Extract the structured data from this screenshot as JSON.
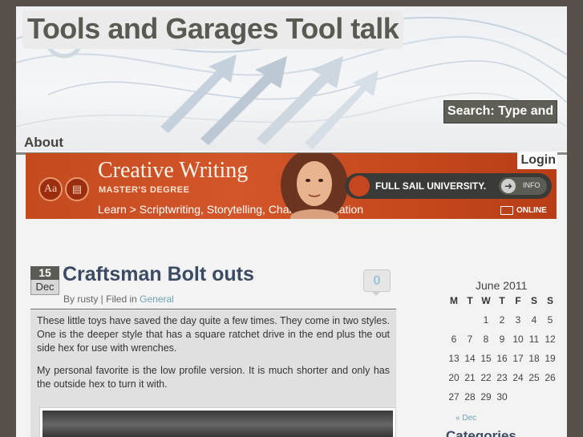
{
  "header": {
    "site_title": "Tools and Garages Tool talk",
    "search_placeholder": "Search: Type and"
  },
  "nav": {
    "items": [
      {
        "label": "About"
      }
    ]
  },
  "login_label": "Login",
  "banner": {
    "aa_label": "Aa",
    "title": "Creative Writing",
    "subtitle": "MASTER'S DEGREE",
    "tagline": "Learn > Scriptwriting, Storytelling, Character Creation",
    "school": "FULL SAIL UNIVERSITY.",
    "info_label": "INFO",
    "online_label": "ONLINE"
  },
  "post": {
    "date_day": "15",
    "date_month": "Dec",
    "title": "Craftsman Bolt outs",
    "comment_count": "0",
    "meta_author": "By rusty | Filed in",
    "meta_category": "General",
    "paragraph_1": "These little toys have saved the day quite a few times. They come in two styles. One is the deeper style that has a square ratchet drive in the end plus the out side hex for use with wrenches.",
    "paragraph_2": "My personal favorite is the low profile version. It is much shorter and only has the outside hex to turn it with."
  },
  "calendar": {
    "caption": "June 2011",
    "headers": [
      "M",
      "T",
      "W",
      "T",
      "F",
      "S",
      "S"
    ],
    "weeks": [
      [
        "",
        "",
        "1",
        "2",
        "3",
        "4",
        "5"
      ],
      [
        "6",
        "7",
        "8",
        "9",
        "10",
        "11",
        "12"
      ],
      [
        "13",
        "14",
        "15",
        "16",
        "17",
        "18",
        "19"
      ],
      [
        "20",
        "21",
        "22",
        "23",
        "24",
        "25",
        "26"
      ],
      [
        "27",
        "28",
        "29",
        "30",
        "",
        "",
        ""
      ]
    ],
    "prev_link": "« Dec"
  },
  "sidebar": {
    "categories_heading": "Categories"
  }
}
